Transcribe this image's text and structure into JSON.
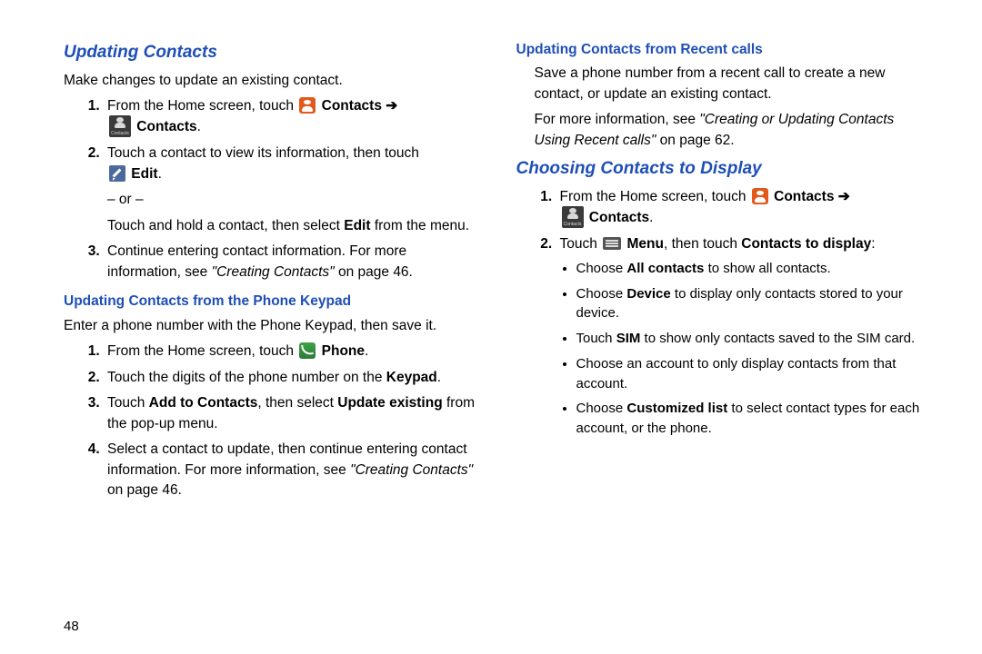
{
  "page_number": "48",
  "left": {
    "h1": "Updating Contacts",
    "intro": "Make changes to update an existing contact.",
    "step1_a": "From the Home screen, touch ",
    "step1_b": " Contacts ➔",
    "step1_c": " Contacts",
    "step1_d": ".",
    "step2_a": "Touch a contact to view its information, then touch ",
    "step2_b": " Edit",
    "step2_c": ".",
    "or_line": "– or –",
    "or_para_a": "Touch and hold a contact, then select ",
    "or_para_b": "Edit",
    "or_para_c": " from the menu.",
    "step3_a": "Continue entering contact information. For more information, see ",
    "step3_b": "\"Creating Contacts\"",
    "step3_c": " on page 46.",
    "h2": "Updating Contacts from the Phone Keypad",
    "keypad_intro": "Enter a phone number with the Phone Keypad, then save it.",
    "kstep1_a": "From the Home screen, touch ",
    "kstep1_b": " Phone",
    "kstep1_c": ".",
    "kstep2_a": "Touch the digits of the phone number on the ",
    "kstep2_b": "Keypad",
    "kstep2_c": ".",
    "kstep3_a": "Touch ",
    "kstep3_b": "Add to Contacts",
    "kstep3_c": ", then select ",
    "kstep3_d": "Update existing",
    "kstep3_e": " from the pop-up menu.",
    "kstep4_a": "Select a contact to update, then continue entering contact information. For more information, see ",
    "kstep4_b": "\"Creating Contacts\"",
    "kstep4_c": " on page 46."
  },
  "right": {
    "h2a": "Updating Contacts from Recent calls",
    "recent_intro": "Save a phone number from a recent call to create a new contact, or update an existing contact.",
    "recent_more_a": "For more information, see ",
    "recent_more_b": "\"Creating or Updating Contacts Using Recent calls\"",
    "recent_more_c": " on page 62.",
    "h1b": "Choosing Contacts to Display",
    "cstep1_a": "From the Home screen, touch ",
    "cstep1_b": " Contacts ➔",
    "cstep1_c": " Contacts",
    "cstep1_d": ".",
    "cstep2_a": "Touch ",
    "cstep2_b": " Menu",
    "cstep2_c": ", then touch ",
    "cstep2_d": "Contacts to display",
    "cstep2_e": ":",
    "bul1_a": "Choose ",
    "bul1_b": "All contacts",
    "bul1_c": " to show all contacts.",
    "bul2_a": "Choose ",
    "bul2_b": "Device",
    "bul2_c": " to display only contacts stored to your device.",
    "bul3_a": "Touch ",
    "bul3_b": "SIM",
    "bul3_c": " to show only contacts saved to the SIM card.",
    "bul4": "Choose an account to only display contacts from that account.",
    "bul5_a": "Choose ",
    "bul5_b": "Customized list",
    "bul5_c": " to select contact types for each account, or the phone."
  }
}
